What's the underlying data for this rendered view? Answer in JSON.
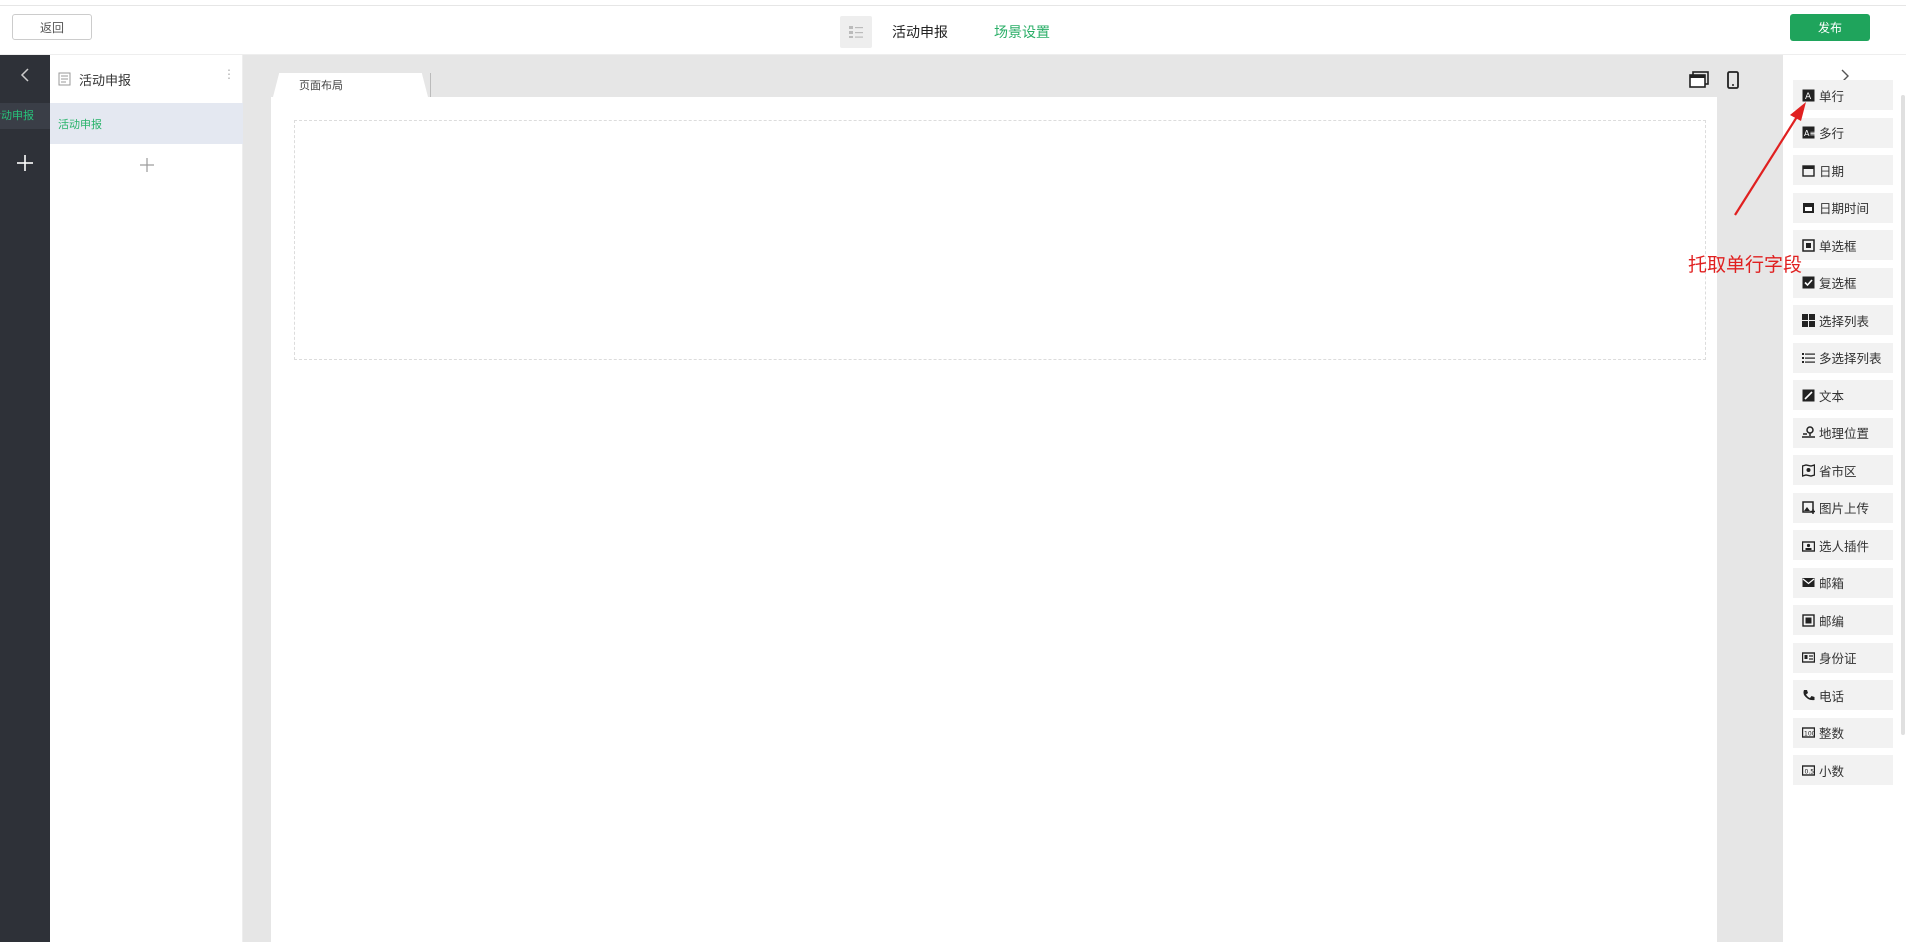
{
  "toolbar": {
    "back_label": "返回",
    "tab_main": "活动申报",
    "tab_scene": "场景设置",
    "publish_label": "发布"
  },
  "sidebar": {
    "active_item": "活动申报"
  },
  "pages_panel": {
    "title": "活动申报",
    "selected_page": "活动申报"
  },
  "canvas": {
    "tab_label": "页面布局"
  },
  "palette": {
    "fields": [
      {
        "label": "单行",
        "icon": "single-line-icon"
      },
      {
        "label": "多行",
        "icon": "multi-line-icon"
      },
      {
        "label": "日期",
        "icon": "calendar-icon"
      },
      {
        "label": "日期时间",
        "icon": "datetime-icon"
      },
      {
        "label": "单选框",
        "icon": "radio-icon"
      },
      {
        "label": "复选框",
        "icon": "checkbox-icon"
      },
      {
        "label": "选择列表",
        "icon": "grid-list-icon"
      },
      {
        "label": "多选择列表",
        "icon": "list-icon"
      },
      {
        "label": "文本",
        "icon": "edit-icon"
      },
      {
        "label": "地理位置",
        "icon": "location-icon"
      },
      {
        "label": "省市区",
        "icon": "map-icon"
      },
      {
        "label": "图片上传",
        "icon": "image-upload-icon"
      },
      {
        "label": "选人插件",
        "icon": "person-icon"
      },
      {
        "label": "邮箱",
        "icon": "mail-icon"
      },
      {
        "label": "邮编",
        "icon": "postcode-icon"
      },
      {
        "label": "身份证",
        "icon": "id-card-icon"
      },
      {
        "label": "电话",
        "icon": "phone-icon"
      },
      {
        "label": "整数",
        "icon": "integer-icon"
      },
      {
        "label": "小数",
        "icon": "decimal-icon"
      }
    ]
  },
  "annotation": {
    "text": "托取单行字段",
    "color": "#e02020"
  },
  "colors": {
    "accent": "#1fa45c",
    "dark_sidebar": "#2e3138"
  }
}
